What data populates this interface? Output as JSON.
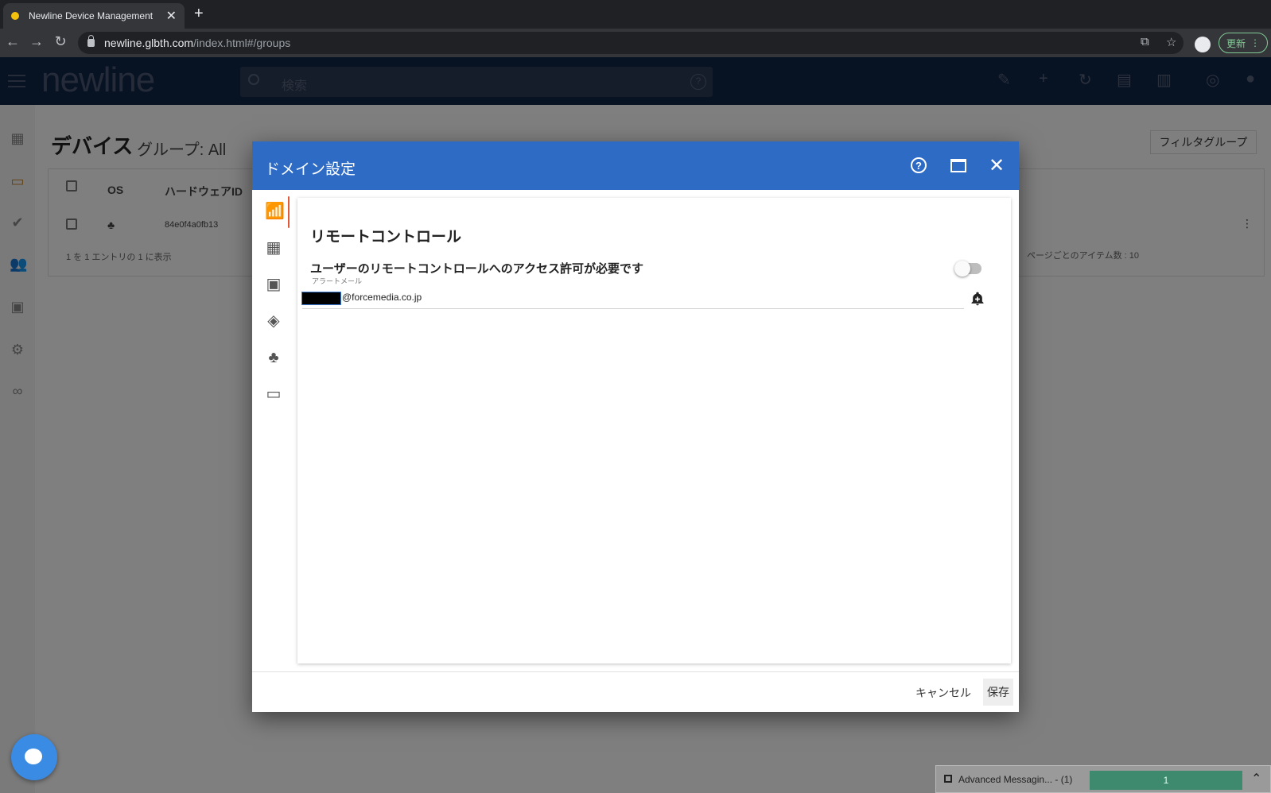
{
  "browser": {
    "tab_title": "Newline Device Management",
    "url_host": "newline.glbth.com",
    "url_path": "/index.html#/groups",
    "update_label": "更新"
  },
  "app": {
    "logo": "newline",
    "search_placeholder": "検索",
    "page_title": "デバイス",
    "page_subtitle": "グループ: All",
    "filter_group_label": "フィルタグループ",
    "table": {
      "columns": [
        "OS",
        "ハードウェアID"
      ],
      "rows": [
        {
          "hardware_id": "84e0f4a0fb13"
        }
      ],
      "footer": "1 を 1 エントリの 1 に表示",
      "items_per_page": "ページごとのアイテム数 : 10"
    }
  },
  "dialog": {
    "title": "ドメイン設定",
    "section_title": "リモートコントロール",
    "permission_label": "ユーザーのリモートコントロールへのアクセス許可が必要です",
    "alert_mail_label": "アラートメール",
    "email_value": "@forcemedia.co.jp",
    "toggle_on": false,
    "cancel_label": "キャンセル",
    "save_label": "保存"
  },
  "messaging": {
    "label": "Advanced Messagin... - (1)",
    "count": "1"
  },
  "colors": {
    "dialog_header": "#2e6bc5",
    "app_header": "#0f2447",
    "active_indicator": "#e05a3a"
  }
}
